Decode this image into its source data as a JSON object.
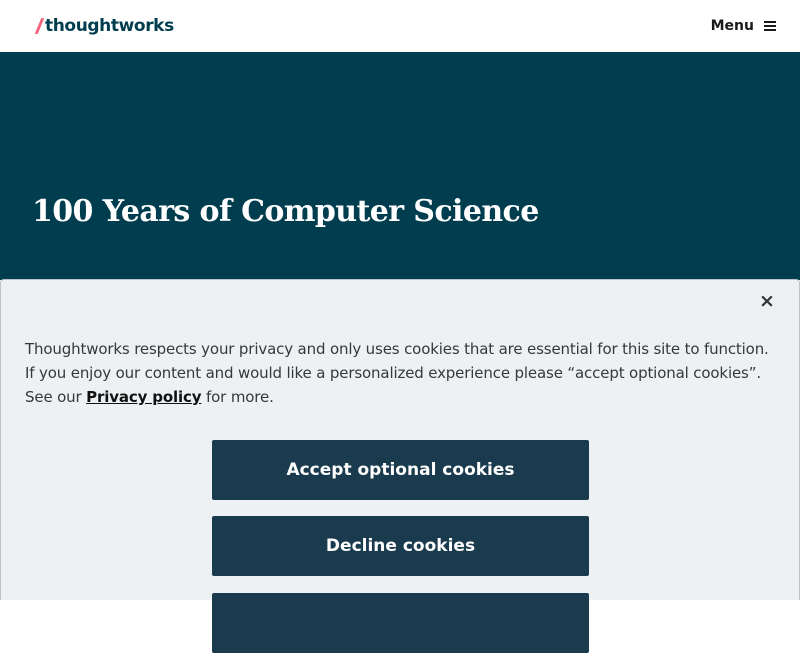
{
  "header": {
    "logo_text": "thoughtworks",
    "menu_label": "Menu"
  },
  "hero": {
    "title": "100 Years of Computer Science"
  },
  "cookie_banner": {
    "text_before_link": "Thoughtworks respects your privacy and only uses cookies that are essential for this site to function. If you enjoy our content and would like a personalized experience please “accept optional cookies”. See our ",
    "privacy_link": "Privacy policy",
    "text_after_link": " for more.",
    "accept_label": "Accept optional cookies",
    "decline_label": "Decline cookies",
    "close_glyph": "×"
  },
  "colors": {
    "brand_teal": "#003d4f",
    "logo_accent": "#f2617a",
    "button_bg": "#1a3a4d",
    "banner_bg": "#edf1f3"
  },
  "icons": {
    "menu": "hamburger-icon",
    "close": "close-icon"
  }
}
